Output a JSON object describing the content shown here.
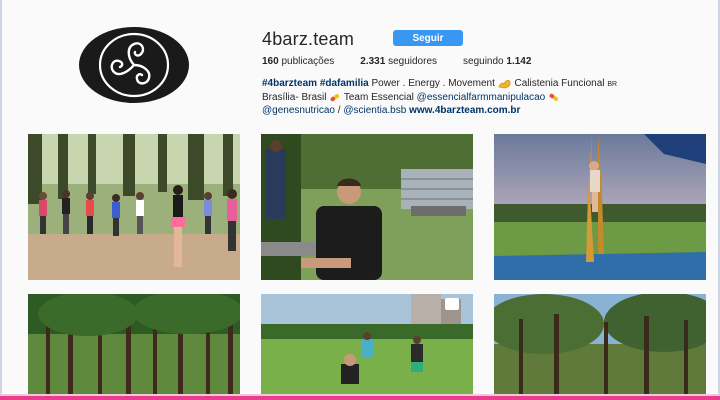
{
  "profile": {
    "username": "4barz.team",
    "follow_label": "Seguir",
    "stats": {
      "posts_count": "160",
      "posts_label": "publicações",
      "followers_count": "2.331",
      "followers_label": "seguidores",
      "following_label": "seguindo",
      "following_count": "1.142"
    },
    "bio": {
      "hashtag1": "#4barzteam",
      "hashtag2": "#dafamilia",
      "tagline": "Power . Energy . Movement",
      "calistenia": "Calistenia Funcional",
      "country": "BR",
      "location": "Brasília- Brasil",
      "team": "Team Essencial",
      "mention1": "@essencialfarmmanipulacao",
      "mention2": "@genesnutricao",
      "separator": "/",
      "mention3": "@scientia.bsb",
      "website": "www.4barzteam.com.br"
    }
  },
  "posts": [
    {
      "name": "group-workout-outdoor"
    },
    {
      "name": "man-in-park"
    },
    {
      "name": "aerial-silks"
    },
    {
      "name": "tall-trees"
    },
    {
      "name": "outdoor-training-video"
    },
    {
      "name": "forest-path"
    }
  ],
  "colors": {
    "follow_button": "#3897f0",
    "link": "#003569",
    "accent_bar": "#e83e8c"
  }
}
